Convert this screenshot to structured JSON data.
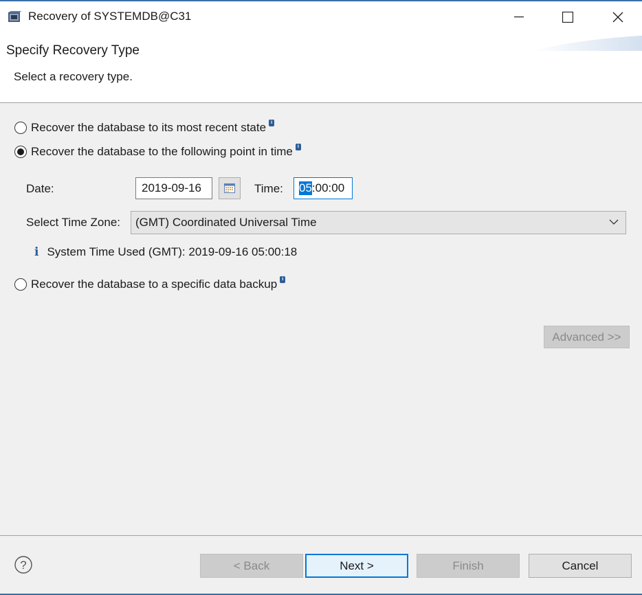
{
  "window": {
    "title": "Recovery of SYSTEMDB@C31",
    "icon": "sap-hana-studio-icon"
  },
  "header": {
    "title": "Specify Recovery Type",
    "subtitle": "Select a recovery type."
  },
  "options": [
    {
      "label": "Recover the database to its most recent state",
      "selected": false
    },
    {
      "label": "Recover the database to the following point in time",
      "selected": true
    },
    {
      "label": "Recover the database to a specific data backup",
      "selected": false
    }
  ],
  "point_in_time": {
    "date_label": "Date:",
    "date_value": "2019-09-16",
    "time_label": "Time:",
    "time_selected_part": "05",
    "time_rest": ":00:00",
    "timezone_label": "Select Time Zone:",
    "timezone_value": "(GMT) Coordinated Universal Time",
    "system_time_text": "System Time Used (GMT): 2019-09-16 05:00:18"
  },
  "advanced_label": "Advanced >>",
  "footer": {
    "back_label": "< Back",
    "next_label": "Next >",
    "finish_label": "Finish",
    "cancel_label": "Cancel"
  },
  "colors": {
    "accent": "#0078d7",
    "info": "#2d5d98",
    "disabled_text": "#8a8a8a"
  }
}
